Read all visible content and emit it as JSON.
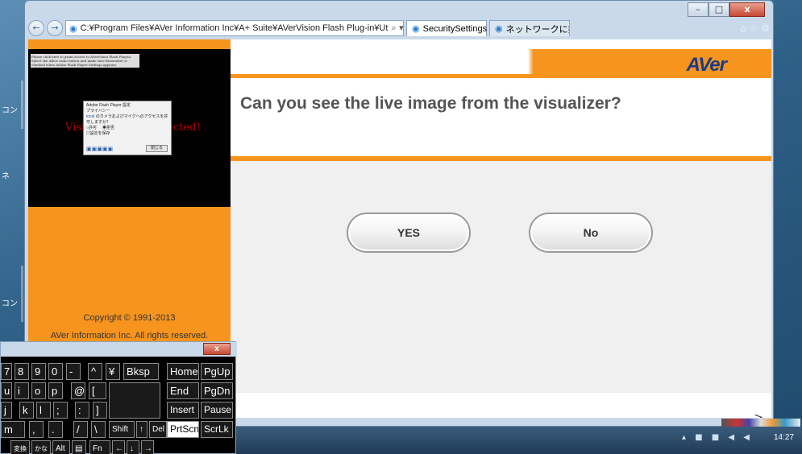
{
  "browser": {
    "address": "C:¥Program Files¥AVer Information Inc¥A+ Suite¥AVerVision Flash Plug-in¥Ut",
    "address_icons": "⌕ ▾ ↻",
    "tab_active": "SecuritySettings",
    "tab_inactive": "ネットワークに接...",
    "tab_close": "×",
    "right_icons": "⌂ ☆ ⚙"
  },
  "window_controls": {
    "minimize": "–",
    "maximize": "□",
    "close": "x"
  },
  "desktop_labels": [
    "コン",
    "ネ",
    "コン"
  ],
  "flash": {
    "note": "Please click here to grant access to AVerVision Flash Plug-in. Select the Allow radio button and make sure Remember is checked when Adobe Flash Player Settings appears.",
    "red_left": "Visi",
    "red_right": "cted!",
    "dialog_title": "Adobe Flash Player 設定",
    "privacy": "プライバシー",
    "local": "local",
    "question_jp": "のカメラおよびマイクへのアクセスを許可しますか？",
    "allow": "許可",
    "deny": "拒否",
    "remember": "設定を保存",
    "close": "閉じる"
  },
  "copyright": {
    "line1": "Copyright © 1991-2013",
    "line2": "AVer Information Inc. All rights reserved."
  },
  "main": {
    "logo": "AVer",
    "question": "Can you see the live image from the visualizer?",
    "yes": "YES",
    "no": "No",
    "scroll_arrow": ">"
  },
  "taskbar": {
    "clock": "14:27",
    "tray_icons": "▴ ■ ■ ◀ ◀"
  },
  "keyboard": {
    "close": "x",
    "row1": [
      "7",
      "8",
      "9",
      "0",
      "-",
      "^",
      "¥",
      "Bksp",
      "Home",
      "PgUp"
    ],
    "row2": [
      "u",
      "i",
      "o",
      "p",
      "@",
      "[",
      "End",
      "PgDn"
    ],
    "row3": [
      "j",
      "k",
      "l",
      ";",
      ":",
      "]",
      "Insert",
      "Pause"
    ],
    "row4": [
      "m",
      ",",
      ".",
      "/",
      "\\",
      "Shift",
      "↑",
      "Del",
      "PrtScn",
      "ScrLk"
    ],
    "row5": [
      "変換",
      "かな",
      "Alt",
      "▤",
      "Fn",
      "←",
      "↓",
      "→"
    ]
  }
}
